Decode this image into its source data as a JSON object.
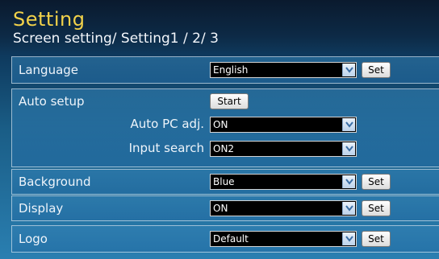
{
  "header": {
    "title": "Setting",
    "subtitle": "Screen setting/ Setting1 / 2/ 3"
  },
  "rows": {
    "language": {
      "label": "Language",
      "value": "English",
      "button": "Set"
    },
    "auto_setup": {
      "label": "Auto setup",
      "start_button": "Start",
      "auto_pc_adj": {
        "label": "Auto PC adj.",
        "value": "ON"
      },
      "input_search": {
        "label": "Input search",
        "value": "ON2"
      }
    },
    "background": {
      "label": "Background",
      "value": "Blue",
      "button": "Set"
    },
    "display": {
      "label": "Display",
      "value": "ON",
      "button": "Set"
    },
    "logo": {
      "label": "Logo",
      "value": "Default",
      "button": "Set"
    }
  },
  "icons": {
    "dropdown": "chevron-down-icon"
  },
  "colors": {
    "title": "#f2d24a",
    "select_bg": "#000000"
  }
}
